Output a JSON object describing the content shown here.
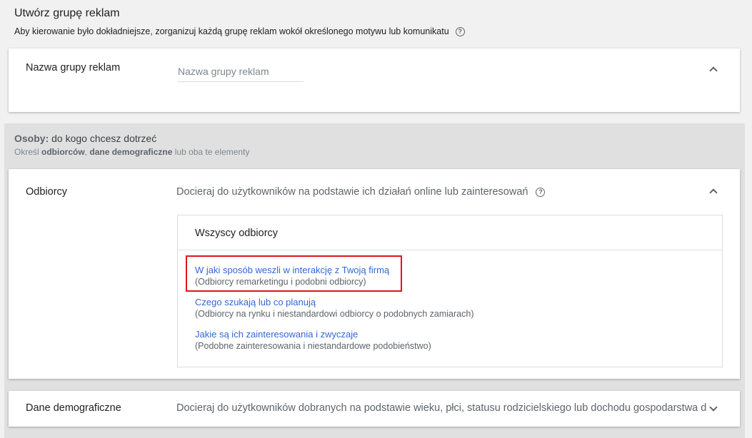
{
  "header": {
    "title": "Utwórz grupę reklam",
    "description": "Aby kierowanie było dokładniejsze, zorganizuj każdą grupę reklam wokół określonego motywu lub komunikatu",
    "help_icon": "?"
  },
  "ad_group_name": {
    "label": "Nazwa grupy reklam",
    "placeholder": "Nazwa grupy reklam",
    "value": ""
  },
  "people": {
    "heading_bold": "Osoby:",
    "heading_rest": " do kogo chcesz dotrzeć",
    "sub_pre": "Określ ",
    "sub_bold1": "odbiorców",
    "sub_mid": ", ",
    "sub_bold2": "dane demograficzne",
    "sub_post": " lub oba te elementy"
  },
  "audiences": {
    "label": "Odbiorcy",
    "description": "Docieraj do użytkowników na podstawie ich działań online lub zainteresowań",
    "help_icon": "?",
    "box_title": "Wszyscy odbiorcy",
    "options": [
      {
        "title": "W jaki sposób weszli w interakcję z Twoją firmą",
        "subtitle": "(Odbiorcy remarketingu i podobni odbiorcy)"
      },
      {
        "title": "Czego szukają lub co planują",
        "subtitle": "(Odbiorcy na rynku i niestandardowi odbiorcy o podobnych zamiarach)"
      },
      {
        "title": "Jakie są ich zainteresowania i zwyczaje",
        "subtitle": "(Podobne zainteresowania i niestandardowe podobieństwo)"
      }
    ],
    "highlight_color": "#e2141e"
  },
  "demographics": {
    "label": "Dane demograficzne",
    "description": "Docieraj do użytkowników dobranych na podstawie wieku, płci, statusu rodzicielskiego lub dochodu gospodarstwa domowego"
  },
  "icons": {
    "collapse": "chevron-up-icon",
    "expand": "chevron-down-icon",
    "help": "help-circle-icon"
  },
  "colors": {
    "link": "#3367d6",
    "highlight": "#e2141e",
    "section_bg": "#e0e0e0"
  }
}
